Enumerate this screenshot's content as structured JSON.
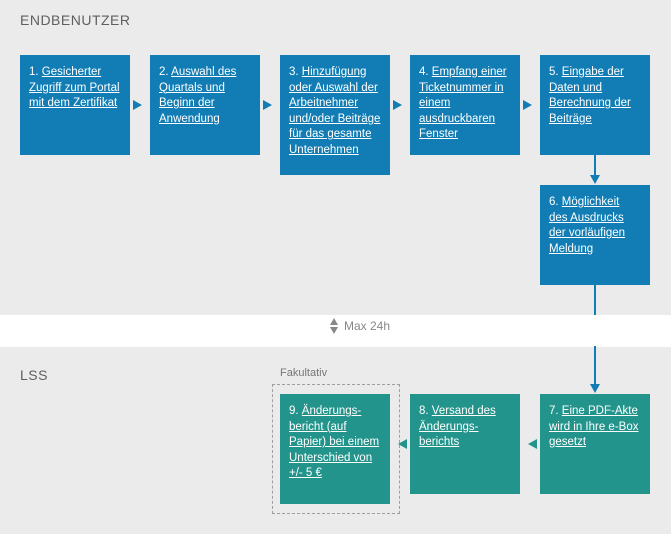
{
  "sections": {
    "endbenutzer": "ENDBENUTZER",
    "lss": "LSS",
    "fakultativ": "Fakultativ"
  },
  "divider": {
    "label": "Max 24h"
  },
  "steps": {
    "s1": {
      "num": "1.",
      "text": "Gesicherter Zugriff zum Portal mit dem Zertifikat"
    },
    "s2": {
      "num": "2.",
      "text": "Auswahl des Quartals und Beginn der Anwendung"
    },
    "s3": {
      "num": "3.",
      "text": "Hinzufügung oder Auswahl der Arbeitnehmer und/oder Beiträge für das gesamte Unternehmen"
    },
    "s4": {
      "num": "4.",
      "text": "Empfang einer Ticketnummer in einem ausdruckbaren Fenster"
    },
    "s5": {
      "num": "5.",
      "text": "Eingabe der Daten und Berechnung der Beiträge"
    },
    "s6": {
      "num": "6.",
      "text": "Möglichkeit des Ausdrucks der vorläufigen Meldung"
    },
    "s7": {
      "num": "7.",
      "text": "Eine PDF-Akte wird in Ihre e-Box gesetzt"
    },
    "s8": {
      "num": "8.",
      "text": "Versand des Änderungs­berichts"
    },
    "s9": {
      "num": "9.",
      "text": "Änderungs­bericht (auf Papier) bei einem Unterschied von +/- 5 €"
    }
  }
}
